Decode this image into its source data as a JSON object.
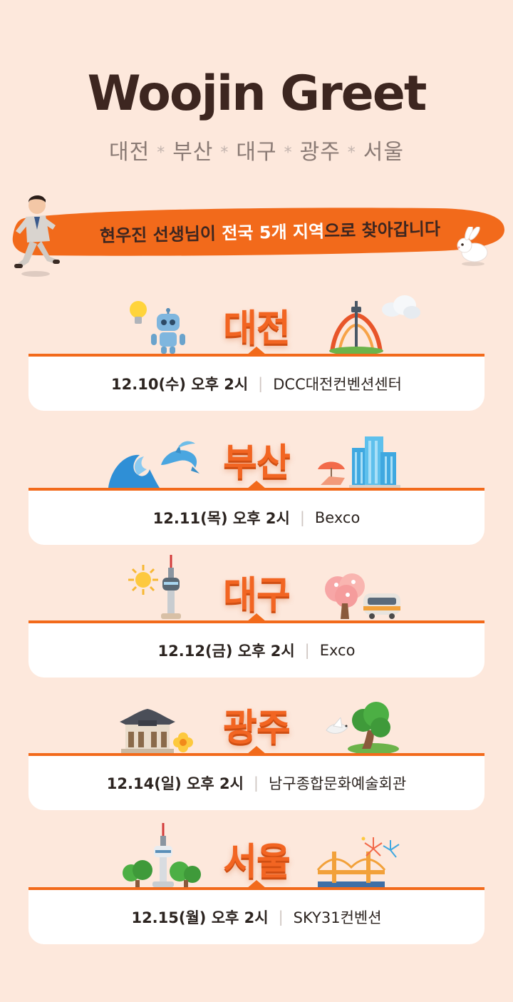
{
  "header": {
    "title": "Woojin Greet",
    "cities": [
      "대전",
      "부산",
      "대구",
      "광주",
      "서울"
    ],
    "separator": "*"
  },
  "banner": {
    "text_part1": "현우진 선생님이 ",
    "text_highlight": "전국 5개 지역",
    "text_part2": "으로 찾아갑니다"
  },
  "events": [
    {
      "city": "대전",
      "date": "12.10(수) 오후 2시",
      "venue": "DCC대전컨벤션센터"
    },
    {
      "city": "부산",
      "date": "12.11(목) 오후 2시",
      "venue": "Bexco"
    },
    {
      "city": "대구",
      "date": "12.12(금) 오후 2시",
      "venue": "Exco"
    },
    {
      "city": "광주",
      "date": "12.14(일) 오후 2시",
      "venue": "남구종합문화예술회관"
    },
    {
      "city": "서울",
      "date": "12.15(월) 오후 2시",
      "venue": "SKY31컨벤션"
    }
  ],
  "colors": {
    "background": "#fde8dc",
    "accent": "#f26a1b",
    "title": "#3d2620"
  }
}
